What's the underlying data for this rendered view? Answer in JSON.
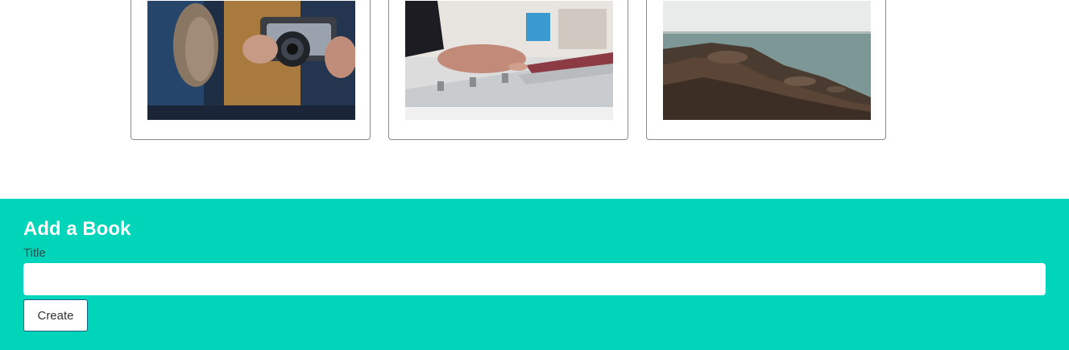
{
  "gallery": {
    "cards": [
      {
        "image": "photo-hands-holding-camera"
      },
      {
        "image": "photo-hand-on-mixing-console"
      },
      {
        "image": "photo-rocky-seashore"
      }
    ]
  },
  "add_book": {
    "heading": "Add a Book",
    "title_label": "Title",
    "title_value": "",
    "title_placeholder": "",
    "create_label": "Create"
  },
  "colors": {
    "footer_background": "#00d4b9",
    "heading_text": "#ffffff",
    "button_border": "#1b5e80"
  }
}
